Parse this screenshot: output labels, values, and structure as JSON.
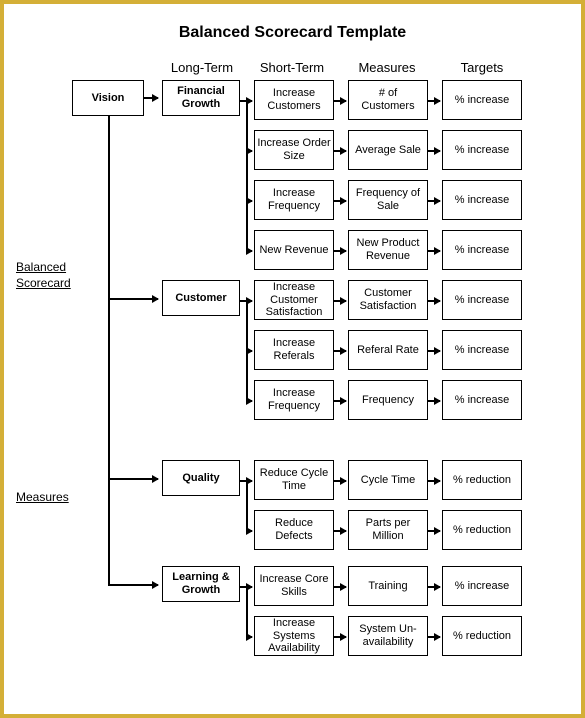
{
  "title": "Balanced Scorecard Template",
  "columns": {
    "long_term": "Long-Term",
    "short_term": "Short-Term",
    "measures": "Measures",
    "targets": "Targets"
  },
  "side_labels": {
    "balanced_scorecard": "Balanced\nScorecard",
    "measures": "Measures"
  },
  "vision": "Vision",
  "perspectives": {
    "financial": "Financial Growth",
    "customer": "Customer",
    "quality": "Quality",
    "learning": "Learning & Growth"
  },
  "rows": [
    {
      "short": "Increase Customers",
      "measure": "# of Customers",
      "target": "% increase"
    },
    {
      "short": "Increase Order Size",
      "measure": "Average Sale",
      "target": "% increase"
    },
    {
      "short": "Increase Frequency",
      "measure": "Frequency of Sale",
      "target": "% increase"
    },
    {
      "short": "New Revenue",
      "measure": "New Product Revenue",
      "target": "% increase"
    },
    {
      "short": "Increase Customer Satisfaction",
      "measure": "Customer Satisfaction",
      "target": "% increase"
    },
    {
      "short": "Increase Referals",
      "measure": "Referal Rate",
      "target": "% increase"
    },
    {
      "short": "Increase Frequency",
      "measure": "Frequency",
      "target": "% increase"
    },
    {
      "short": "Reduce Cycle Time",
      "measure": "Cycle Time",
      "target": "% reduction"
    },
    {
      "short": "Reduce Defects",
      "measure": "Parts per Million",
      "target": "% reduction"
    },
    {
      "short": "Increase Core Skills",
      "measure": "Training",
      "target": "% increase"
    },
    {
      "short": "Increase Systems Availability",
      "measure": "System Un-availability",
      "target": "% reduction"
    }
  ]
}
